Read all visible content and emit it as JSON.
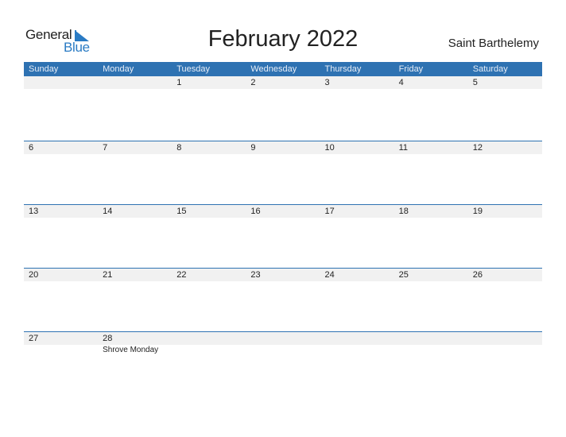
{
  "logo": {
    "word1": "General",
    "word2": "Blue",
    "accent": "#2a7bc4"
  },
  "title": "February 2022",
  "country": "Saint Barthelemy",
  "header_color": "#2e72b2",
  "weekdays": [
    "Sunday",
    "Monday",
    "Tuesday",
    "Wednesday",
    "Thursday",
    "Friday",
    "Saturday"
  ],
  "weeks": [
    {
      "days": [
        "",
        "",
        "1",
        "2",
        "3",
        "4",
        "5"
      ],
      "events": [
        "",
        "",
        "",
        "",
        "",
        "",
        ""
      ]
    },
    {
      "days": [
        "6",
        "7",
        "8",
        "9",
        "10",
        "11",
        "12"
      ],
      "events": [
        "",
        "",
        "",
        "",
        "",
        "",
        ""
      ]
    },
    {
      "days": [
        "13",
        "14",
        "15",
        "16",
        "17",
        "18",
        "19"
      ],
      "events": [
        "",
        "",
        "",
        "",
        "",
        "",
        ""
      ]
    },
    {
      "days": [
        "20",
        "21",
        "22",
        "23",
        "24",
        "25",
        "26"
      ],
      "events": [
        "",
        "",
        "",
        "",
        "",
        "",
        ""
      ]
    },
    {
      "days": [
        "27",
        "28",
        "",
        "",
        "",
        "",
        ""
      ],
      "events": [
        "",
        "Shrove Monday",
        "",
        "",
        "",
        "",
        ""
      ]
    }
  ]
}
